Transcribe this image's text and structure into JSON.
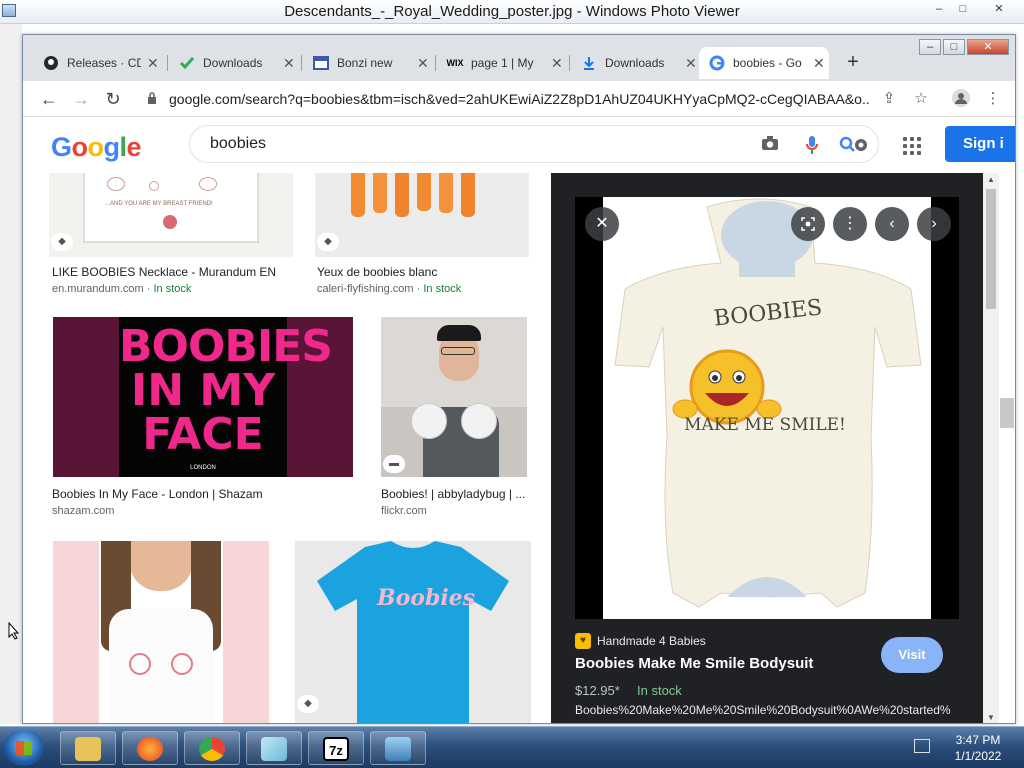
{
  "photo_viewer": {
    "title": "Descendants_-_Royal_Wedding_poster.jpg - Windows Photo Viewer",
    "controls": [
      "–",
      "□",
      "✕"
    ]
  },
  "browser": {
    "tabs": [
      {
        "label": "Releases · CD",
        "icon": "github-icon"
      },
      {
        "label": "Downloads",
        "icon": "download-icon"
      },
      {
        "label": "Bonzi new",
        "icon": "page-icon"
      },
      {
        "label": "page 1 | My",
        "icon": "wix-icon"
      },
      {
        "label": "Downloads",
        "icon": "download-icon"
      },
      {
        "label": "boobies - Go",
        "icon": "google-icon",
        "active": true
      }
    ],
    "url": "google.com/search?q=boobies&tbm=isch&ved=2ahUKEwiAiZ2Z8pD1AhUZ04UKHYyaCpMQ2-cCegQIABAA&o..."
  },
  "google": {
    "logo": "Google",
    "query": "boobies",
    "sign_in": "Sign i"
  },
  "results": [
    {
      "title": "LIKE BOOBIES Necklace - Murandum EN",
      "source": "en.murandum.com",
      "stock": "In stock"
    },
    {
      "title": "Yeux de boobies blanc",
      "source": "caleri-flyfishing.com",
      "stock": "In stock"
    },
    {
      "title": "Boobies In My Face - London | Shazam",
      "source": "shazam.com",
      "stock": ""
    },
    {
      "title": "Boobies! | abbyladybug | ...",
      "source": "flickr.com",
      "stock": ""
    }
  ],
  "result_images": {
    "necklace_text": "...AND YOU ARE MY BREAST FRIEND!",
    "poster_line1": "BOOBIES",
    "poster_line2": "IN MY",
    "poster_line3": "FACE",
    "poster_small": "LONDON",
    "tshirt_text": "Boobies"
  },
  "preview": {
    "shirt_top": "BOOBIES",
    "shirt_bottom": "MAKE ME SMILE!",
    "source": "Handmade 4 Babies",
    "title": "Boobies Make Me Smile Bodysuit",
    "price": "$12.95*",
    "stock": "In stock",
    "description": "Boobies%20Make%20Me%20Smile%20Bodysuit%0AWe%20started%",
    "visit": "Visit"
  },
  "taskbar": {
    "time": "3:47 PM",
    "date": "1/1/2022",
    "items": [
      "explorer-icon",
      "firefox-icon",
      "chrome-icon",
      "notepad-icon",
      "7zip-icon",
      "photo-viewer-icon"
    ]
  },
  "colors": {
    "google_blue": "#4285f4",
    "google_red": "#ea4335",
    "google_yellow": "#fbbc05",
    "google_green": "#34a853",
    "stock_green": "#188038",
    "signin_blue": "#1a73e8"
  }
}
